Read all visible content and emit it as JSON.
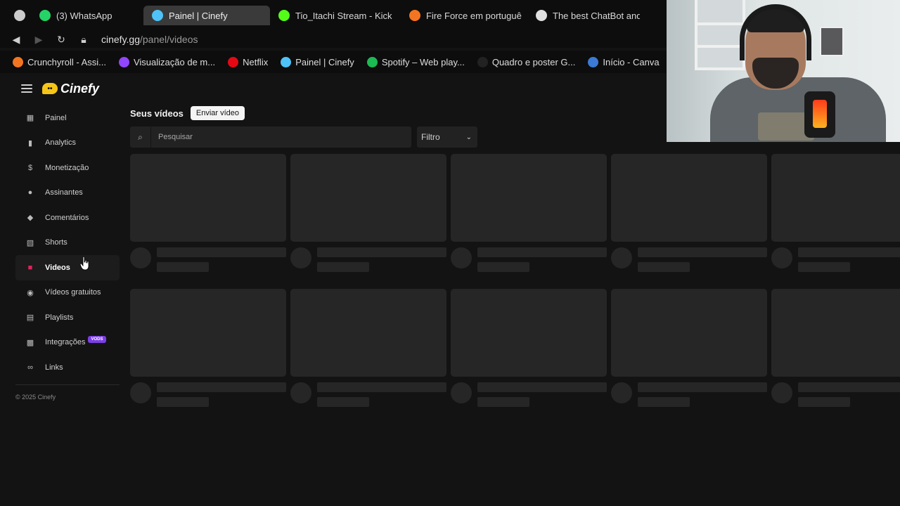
{
  "browser": {
    "tabs": [
      {
        "label": "",
        "icon": "window-icon",
        "color": "#cccccc"
      },
      {
        "label": "(3) WhatsApp",
        "icon": "whatsapp-icon",
        "color": "#25d366"
      },
      {
        "label": "Painel | Cinefy",
        "icon": "cinefy-icon",
        "color": "#4fc3f7",
        "active": true
      },
      {
        "label": "Tio_Itachi Stream - Kick",
        "icon": "kick-icon",
        "color": "#53fc18"
      },
      {
        "label": "Fire Force em portuguê",
        "icon": "crunchyroll-icon",
        "color": "#f47521"
      },
      {
        "label": "The best ChatBot and V",
        "icon": "chatbot-icon",
        "color": "#e0e0e0"
      }
    ],
    "url_domain": "cinefy.gg",
    "url_path": "/panel/videos",
    "bookmarks": [
      {
        "label": "Crunchyroll - Assi...",
        "icon": "crunchyroll-icon",
        "color": "#f47521"
      },
      {
        "label": "Visualização de m...",
        "icon": "twitch-icon",
        "color": "#9146ff"
      },
      {
        "label": "Netflix",
        "icon": "netflix-icon",
        "color": "#e50914"
      },
      {
        "label": "Painel | Cinefy",
        "icon": "cinefy-icon",
        "color": "#4fc3f7"
      },
      {
        "label": "Spotify – Web play...",
        "icon": "spotify-icon",
        "color": "#1db954"
      },
      {
        "label": "Quadro e poster G...",
        "icon": "poster-icon",
        "color": "#222222"
      },
      {
        "label": "Início - Canva",
        "icon": "canva-icon",
        "color": "#3a7bd5"
      }
    ]
  },
  "app": {
    "logo_text": "Cinefy",
    "sidebar": {
      "items": [
        {
          "label": "Painel",
          "icon": "dashboard-icon",
          "glyph": "▦"
        },
        {
          "label": "Analytics",
          "icon": "analytics-icon",
          "glyph": "▮"
        },
        {
          "label": "Monetização",
          "icon": "monetization-icon",
          "glyph": "$"
        },
        {
          "label": "Assinantes",
          "icon": "subscribers-icon",
          "glyph": "●"
        },
        {
          "label": "Comentários",
          "icon": "comments-icon",
          "glyph": "◆"
        },
        {
          "label": "Shorts",
          "icon": "shorts-icon",
          "glyph": "▧"
        },
        {
          "label": "Videos",
          "icon": "videos-icon",
          "glyph": "■",
          "active": true
        },
        {
          "label": "Vídeos gratuitos",
          "icon": "free-videos-icon",
          "glyph": "◉"
        },
        {
          "label": "Playlists",
          "icon": "playlists-icon",
          "glyph": "▤"
        },
        {
          "label": "Integrações",
          "icon": "integrations-icon",
          "glyph": "▩",
          "badge": "VODS"
        },
        {
          "label": "Links",
          "icon": "link-icon",
          "glyph": "∞"
        }
      ],
      "copyright": "© 2025 Cinefy"
    },
    "main": {
      "title": "Seus vídeos",
      "upload_label": "Enviar vídeo",
      "search_placeholder": "Pesquisar",
      "filter_label": "Filtro"
    }
  }
}
